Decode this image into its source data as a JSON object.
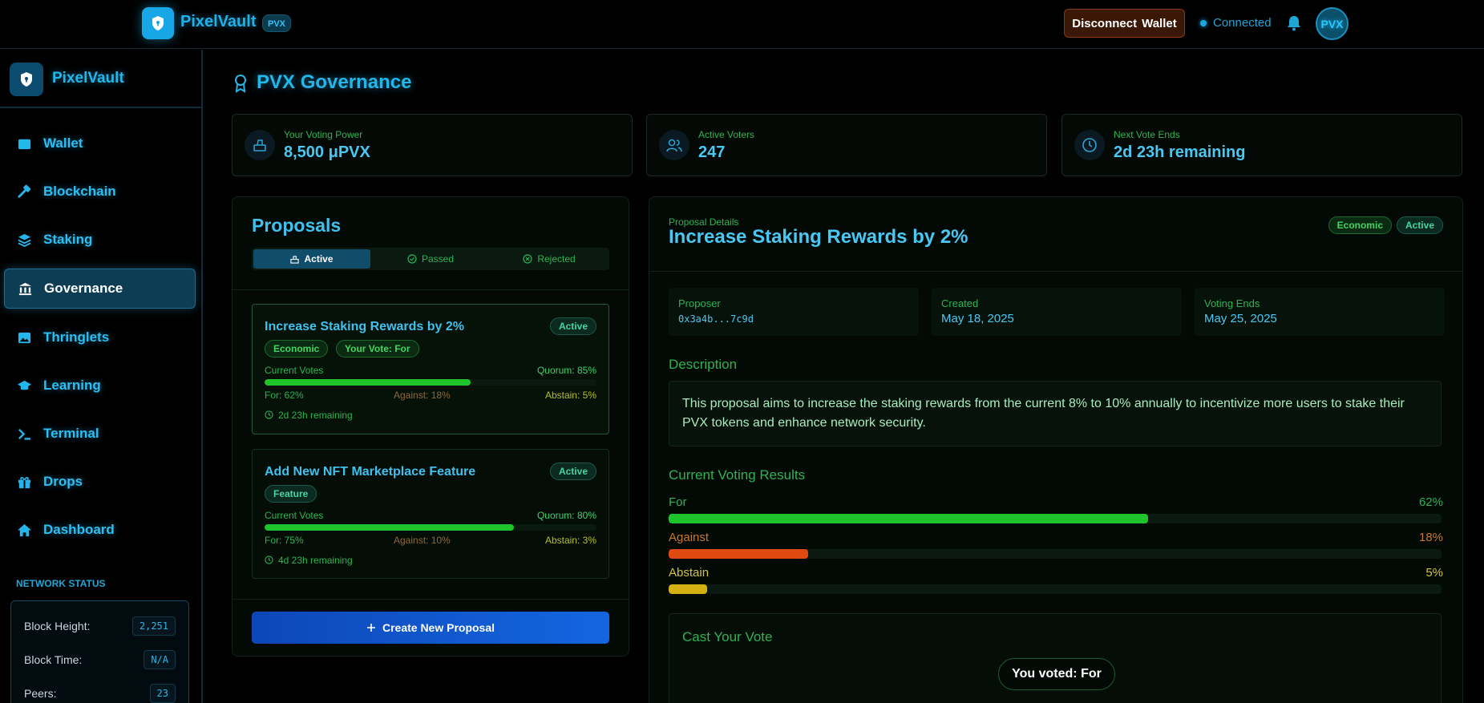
{
  "topbar": {
    "brand": "PixelVault",
    "tag": "PVX",
    "disconnect_label_1": "Disconnect",
    "disconnect_label_2": "Wallet",
    "status": "Connected",
    "avatar": "PVX"
  },
  "sidebar": {
    "brand": "PixelVault",
    "items": [
      {
        "label": "Wallet",
        "icon": "wallet-icon"
      },
      {
        "label": "Blockchain",
        "icon": "hammer-icon"
      },
      {
        "label": "Staking",
        "icon": "layers-icon"
      },
      {
        "label": "Governance",
        "icon": "bank-icon",
        "active": true
      },
      {
        "label": "Thringlets",
        "icon": "image-icon"
      },
      {
        "label": "Learning",
        "icon": "graduation-cap-icon"
      },
      {
        "label": "Terminal",
        "icon": "terminal-icon"
      },
      {
        "label": "Drops",
        "icon": "gift-icon"
      },
      {
        "label": "Dashboard",
        "icon": "home-icon"
      }
    ],
    "network": {
      "title": "NETWORK STATUS",
      "rows": [
        {
          "label": "Block Height:",
          "value": "2,251"
        },
        {
          "label": "Block Time:",
          "value": "N/A"
        },
        {
          "label": "Peers:",
          "value": "23"
        }
      ]
    }
  },
  "page": {
    "title": "PVX Governance"
  },
  "stats": [
    {
      "label": "Your Voting Power",
      "value": "8,500 μPVX",
      "icon": "vote-box-icon"
    },
    {
      "label": "Active Voters",
      "value": "247",
      "icon": "users-icon"
    },
    {
      "label": "Next Vote Ends",
      "value": "2d 23h remaining",
      "icon": "clock-icon"
    }
  ],
  "proposals": {
    "title": "Proposals",
    "tabs": [
      "Active",
      "Passed",
      "Rejected"
    ],
    "active_tab": "Active",
    "list": [
      {
        "title": "Increase Staking Rewards by 2%",
        "status": "Active",
        "tags": [
          "Economic",
          "Your Vote: For"
        ],
        "current_votes_label": "Current Votes",
        "quorum": "Quorum: 85%",
        "for_pct": 62,
        "for": "For: 62%",
        "against": "Against: 18%",
        "abstain": "Abstain: 5%",
        "remaining": "2d 23h remaining"
      },
      {
        "title": "Add New NFT Marketplace Feature",
        "status": "Active",
        "tags": [
          "Feature"
        ],
        "current_votes_label": "Current Votes",
        "quorum": "Quorum: 80%",
        "for_pct": 75,
        "for": "For: 75%",
        "against": "Against: 10%",
        "abstain": "Abstain: 3%",
        "remaining": "4d 23h remaining"
      }
    ],
    "create_button": "Create New Proposal"
  },
  "detail": {
    "kicker": "Proposal Details",
    "title": "Increase Staking Rewards by 2%",
    "badges": [
      "Economic",
      "Active"
    ],
    "info": [
      {
        "label": "Proposer",
        "value": "0x3a4b...7c9d"
      },
      {
        "label": "Created",
        "value": "May 18, 2025"
      },
      {
        "label": "Voting Ends",
        "value": "May 25, 2025"
      }
    ],
    "description_title": "Description",
    "description": "This proposal aims to increase the staking rewards from the current 8% to 10% annually to incentivize more users to stake their PVX tokens and enhance network security.",
    "results_title": "Current Voting Results",
    "results": [
      {
        "label": "For",
        "pct_text": "62%",
        "pct": 62,
        "color": "#1fc42a"
      },
      {
        "label": "Against",
        "pct_text": "18%",
        "pct": 18,
        "color": "#e04a12"
      },
      {
        "label": "Abstain",
        "pct_text": "5%",
        "pct": 5,
        "color": "#d4b012"
      }
    ],
    "cast_title": "Cast Your Vote",
    "voted_text": "You voted: For"
  },
  "colors": {
    "accent_cyan": "#22b6ea",
    "accent_green": "#2db452",
    "for_green": "#1fc42a",
    "against_orange": "#e04a12",
    "abstain_yellow": "#d4b012"
  }
}
